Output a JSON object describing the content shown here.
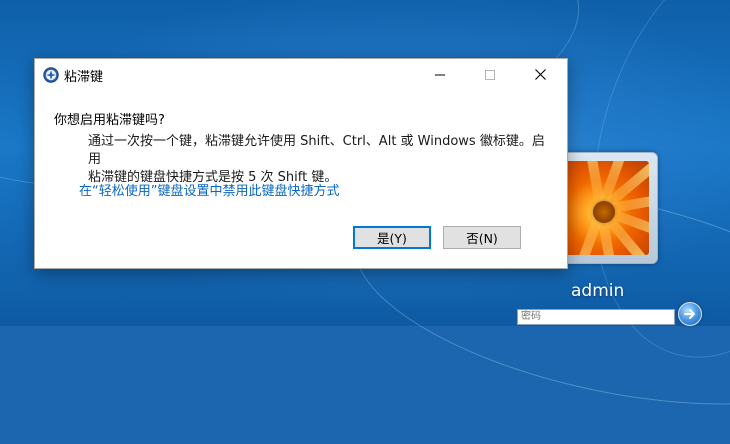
{
  "dialog": {
    "title": "粘滞键",
    "question": "你想启用粘滞键吗?",
    "description_line1": "通过一次按一个键，粘滞键允许使用 Shift、Ctrl、Alt 或 Windows 徽标键。启用",
    "description_line2": "粘滞键的键盘快捷方式是按 5 次 Shift 键。",
    "link_text": "在“轻松使用”键盘设置中禁用此键盘快捷方式",
    "yes_label": "是(Y)",
    "no_label": "否(N)"
  },
  "login": {
    "username": "admin",
    "password_placeholder": "密码"
  },
  "colors": {
    "link": "#0b67c7",
    "default_button_border": "#0078d7",
    "desktop_blue": "#1a78c7"
  },
  "icons": {
    "title_icon": "accessibility-icon",
    "go": "arrow-right-icon"
  }
}
